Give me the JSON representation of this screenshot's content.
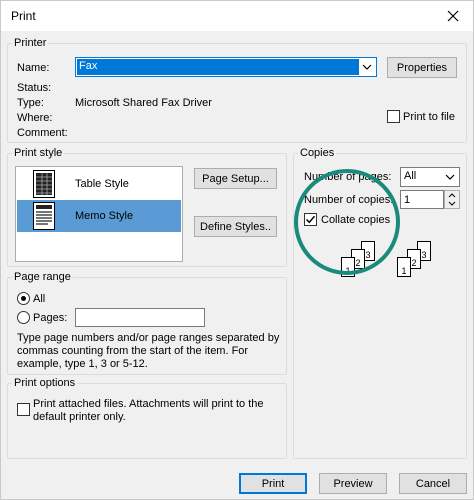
{
  "window": {
    "title": "Print"
  },
  "printer": {
    "legend": "Printer",
    "name_label": "Name:",
    "name_value": "Fax",
    "properties_label": "Properties",
    "status_label": "Status:",
    "status_value": "",
    "type_label": "Type:",
    "type_value": "Microsoft Shared Fax Driver",
    "where_label": "Where:",
    "comment_label": "Comment:",
    "print_to_file_label": "Print to file"
  },
  "print_style": {
    "legend": "Print style",
    "styles": [
      {
        "name": "Table Style",
        "icon": "table-style-icon"
      },
      {
        "name": "Memo Style",
        "icon": "memo-style-icon"
      }
    ],
    "page_setup_label": "Page Setup...",
    "define_styles_label": "Define Styles.."
  },
  "copies": {
    "legend": "Copies",
    "num_pages_label": "Number of pages:",
    "num_pages_value": "All",
    "num_copies_label": "Number of copies:",
    "num_copies_value": "1",
    "collate_label": "Collate copies",
    "collate_checked": true,
    "sheet_numbers": [
      "1",
      "2",
      "3"
    ]
  },
  "page_range": {
    "legend": "Page range",
    "all_label": "All",
    "pages_label": "Pages:",
    "hint": "Type page numbers and/or page ranges separated by commas counting from the start of the item.  For example, type 1, 3 or 5-12."
  },
  "print_options": {
    "legend": "Print options",
    "attached_label": "Print attached files.  Attachments will print to the default printer only."
  },
  "footer": {
    "print_label": "Print",
    "preview_label": "Preview",
    "cancel_label": "Cancel"
  },
  "colors": {
    "selection": "#5b9bd5",
    "combo_highlight": "#0078d7",
    "annotation_circle": "#1a8a7c"
  }
}
